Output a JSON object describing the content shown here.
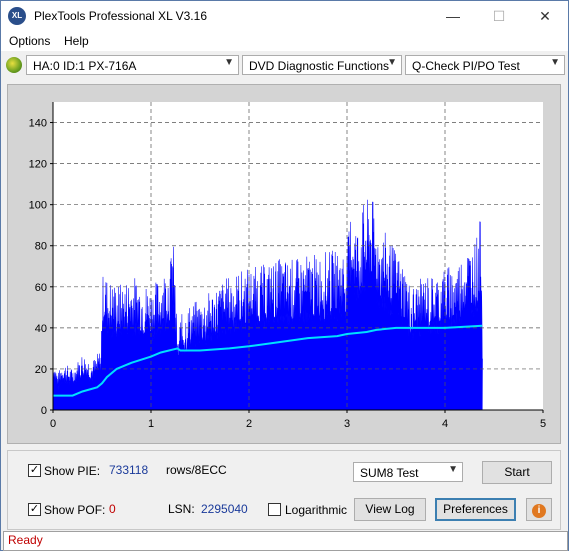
{
  "app": {
    "title": "PlexTools Professional XL V3.16",
    "icon_text": "XL"
  },
  "window_controls": {
    "minimize": "—",
    "maximize": "☐",
    "close": "✕"
  },
  "menu": [
    {
      "label": "Options"
    },
    {
      "label": "Help"
    }
  ],
  "toolbar": {
    "drive": "HA:0 ID:1  PX-716A",
    "function": "DVD Diagnostic Functions",
    "test": "Q-Check PI/PO Test"
  },
  "chart_data": {
    "type": "area",
    "x_ticks": [
      "0",
      "1",
      "2",
      "3",
      "4",
      "5"
    ],
    "y_ticks": [
      "0",
      "20",
      "40",
      "60",
      "80",
      "100",
      "120",
      "140"
    ],
    "xlim": [
      0,
      5
    ],
    "ylim": [
      0,
      150
    ],
    "grid": true,
    "colors": {
      "pie": "#0000ff",
      "sum8": "#00e0ff",
      "plot_bg": "#ffffff",
      "frame_bg": "#d4d4d4"
    },
    "pie_envelope": {
      "x": [
        0,
        0.05,
        0.1,
        0.2,
        0.3,
        0.4,
        0.49,
        0.5,
        0.52,
        0.55,
        0.6,
        0.7,
        0.8,
        0.9,
        1.0,
        1.1,
        1.2,
        1.22,
        1.25,
        1.27,
        1.3,
        1.4,
        1.5,
        1.6,
        1.7,
        1.8,
        1.9,
        2.0,
        2.1,
        2.2,
        2.3,
        2.4,
        2.5,
        2.6,
        2.7,
        2.8,
        2.9,
        3.0,
        3.05,
        3.1,
        3.15,
        3.2,
        3.25,
        3.3,
        3.4,
        3.5,
        3.6,
        3.65,
        3.7,
        3.8,
        3.9,
        4.0,
        4.1,
        4.15,
        4.2,
        4.3,
        4.35,
        4.37,
        4.38
      ],
      "y": [
        26,
        18,
        24,
        20,
        28,
        24,
        30,
        60,
        72,
        65,
        63,
        62,
        66,
        64,
        60,
        66,
        74,
        90,
        62,
        34,
        46,
        52,
        54,
        58,
        62,
        66,
        68,
        70,
        70,
        72,
        74,
        74,
        74,
        76,
        76,
        78,
        78,
        80,
        104,
        90,
        100,
        102,
        106,
        92,
        86,
        78,
        70,
        60,
        62,
        66,
        66,
        70,
        72,
        74,
        80,
        82,
        90,
        98,
        40
      ]
    },
    "sum8_curve": {
      "x": [
        0,
        0.2,
        0.3,
        0.45,
        0.5,
        0.55,
        0.65,
        0.8,
        1.0,
        1.1,
        1.27,
        1.3,
        1.5,
        1.8,
        2.0,
        2.3,
        2.6,
        2.9,
        3.0,
        3.2,
        3.3,
        3.5,
        4.0,
        4.38
      ],
      "y": [
        7,
        7,
        9,
        11,
        13,
        16,
        20,
        23,
        26,
        28,
        30,
        29,
        29,
        30,
        31,
        33,
        35,
        36,
        37,
        38,
        39,
        40,
        40,
        41
      ]
    }
  },
  "panel": {
    "show_pie_label": "Show PIE:",
    "pie_value": "733118",
    "pie_unit": "rows/8ECC",
    "show_pof_label": "Show POF:",
    "pof_value": "0",
    "lsn_label": "LSN:",
    "lsn_value": "2295040",
    "logarithmic_label": "Logarithmic",
    "sum_select": "SUM8 Test",
    "start_button": "Start",
    "view_log_button": "View Log",
    "preferences_button": "Preferences",
    "info_icon": "i",
    "checkmark": "✓"
  },
  "status": {
    "text": "Ready"
  }
}
